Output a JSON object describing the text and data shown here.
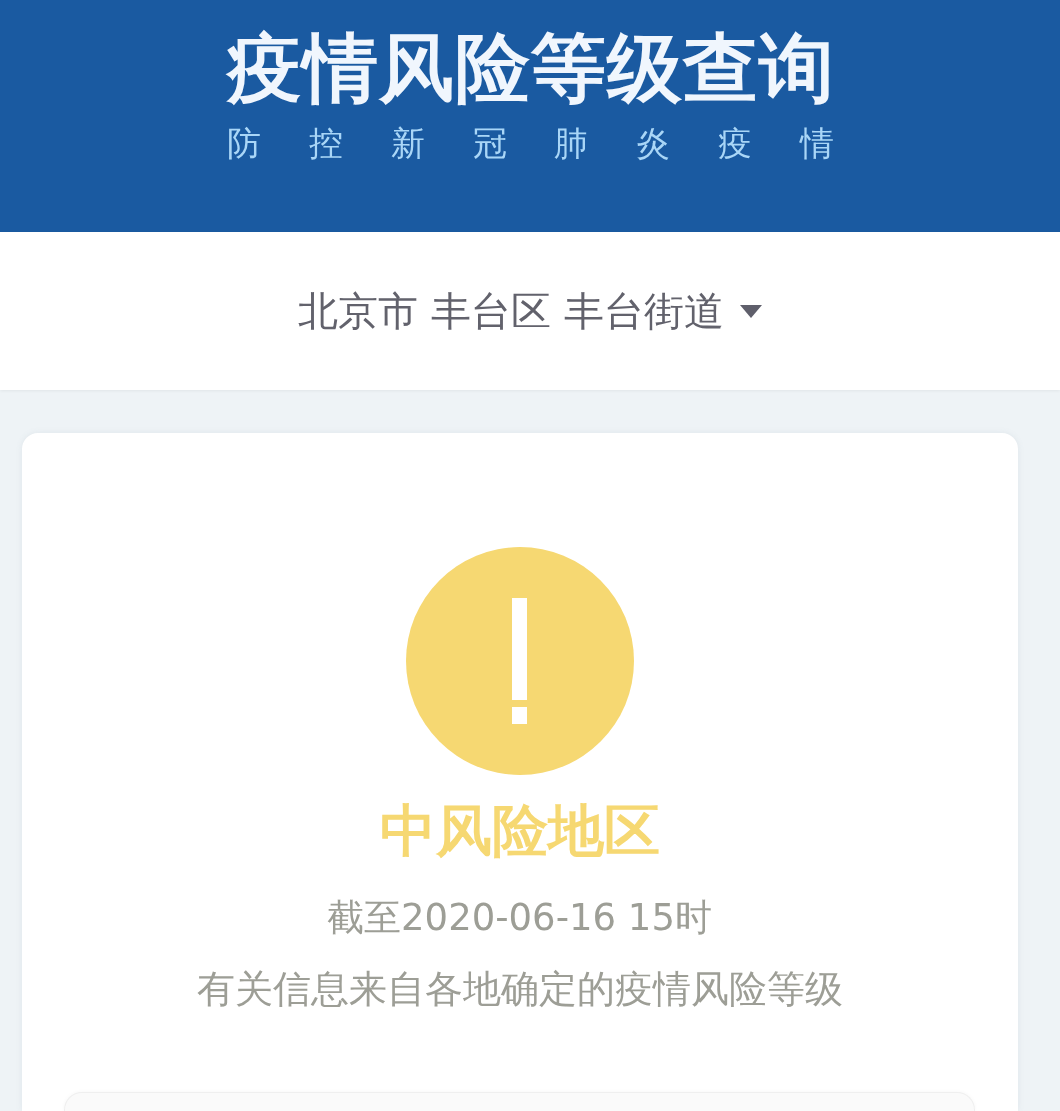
{
  "header": {
    "title": "疫情风险等级查询",
    "subtitle": "防控新冠肺炎疫情"
  },
  "location": {
    "value": "北京市 丰台区 丰台街道"
  },
  "result": {
    "risk": {
      "kind": "medium",
      "label": "中风险地区"
    },
    "updated": "截至2020-06-16 15时",
    "note": "有关信息来自各地确定的疫情风险等级"
  }
}
